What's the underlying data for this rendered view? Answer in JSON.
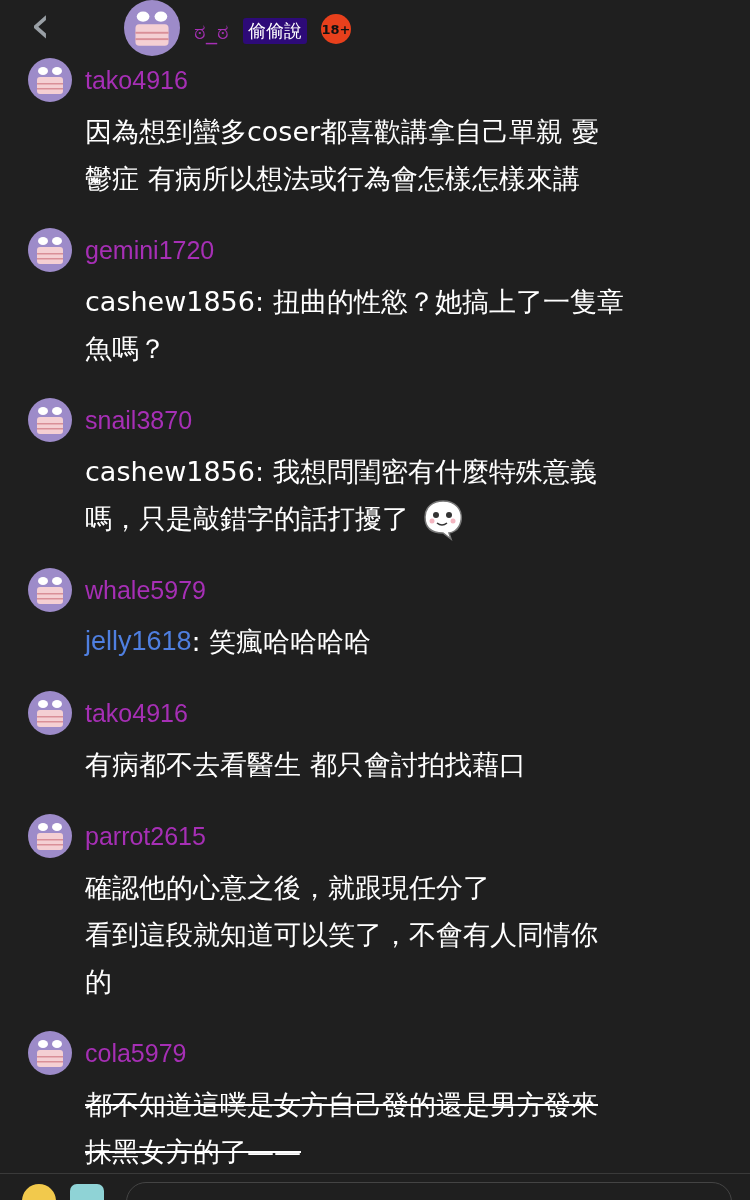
{
  "header": {
    "back": "‹",
    "title": "ಠ_ಠ",
    "board": "偷偷說",
    "rating": "18+"
  },
  "comments": [
    {
      "author": "tako4916",
      "lines": [
        "因為想到蠻多coser都喜歡講拿自己單親 憂",
        "鬱症 有病所以想法或行為會怎樣怎樣來講"
      ],
      "struck": false
    },
    {
      "author": "gemini1720",
      "lines": [
        "cashew1856: 扭曲的性慾？她搞上了一隻章",
        "魚嗎？"
      ],
      "struck": false
    },
    {
      "author": "snail3870",
      "lines": [
        "cashew1856: 我想問閨密有什麼特殊意義",
        "嗎，只是敲錯字的話打擾了"
      ],
      "struck": false,
      "sticker": true
    },
    {
      "author": "whale5979",
      "mention": "jelly1618",
      "lines": [
        ": 笑瘋哈哈哈哈"
      ],
      "struck": false
    },
    {
      "author": "tako4916",
      "lines": [
        "有病都不去看醫生 都只會討拍找藉口"
      ],
      "struck": false
    },
    {
      "author": "parrot2615",
      "lines": [
        "確認他的心意之後，就跟現任分了",
        "看到這段就知道可以笑了，不會有人同情你",
        "的"
      ],
      "struck": false
    },
    {
      "author": "cola5979",
      "lines": [
        "都不知道這噗是女方自己發的還是男方發來",
        "抹黑女方的了——"
      ],
      "struck": true
    }
  ]
}
